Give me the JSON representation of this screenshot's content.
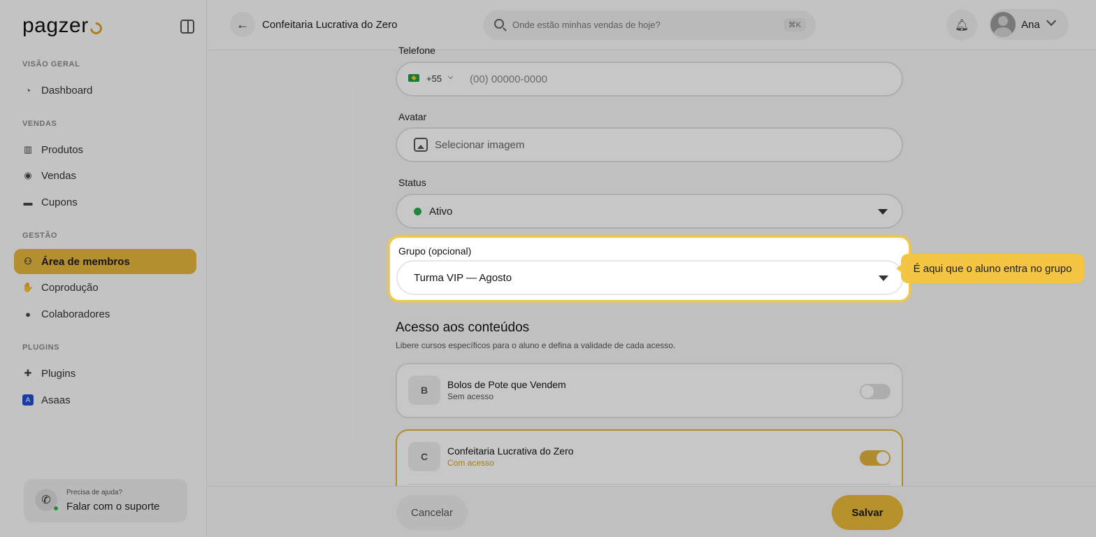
{
  "app": {
    "logo_text": "pagzer",
    "logo_accent": "#e2a21c"
  },
  "sidebar": {
    "sections": [
      {
        "title": "VISÃO GERAL"
      },
      {
        "title": "VENDAS"
      },
      {
        "title": "GESTÃO"
      },
      {
        "title": "PLUGINS"
      }
    ],
    "items": [
      {
        "label": "Dashboard",
        "icon": "gauge-icon"
      },
      {
        "label": "Produtos",
        "icon": "products-icon"
      },
      {
        "label": "Vendas",
        "icon": "sales-icon"
      },
      {
        "label": "Cupons",
        "icon": "coupon-icon"
      },
      {
        "label": "Área de membros",
        "icon": "users-icon",
        "active": true
      },
      {
        "label": "Coprodução",
        "icon": "handshake-icon"
      },
      {
        "label": "Colaboradores",
        "icon": "person-icon"
      },
      {
        "label": "Plugins",
        "icon": "puzzle-icon"
      },
      {
        "label": "Asaas",
        "icon": "asaas-icon"
      }
    ],
    "help": {
      "small": "Precisa de ajuda?",
      "big": "Falar com o suporte"
    }
  },
  "header": {
    "title": "Confeitaria Lucrativa do Zero",
    "search_placeholder": "Onde estão minhas vendas de hoje?",
    "shortcut": "⌘K",
    "user_name": "Ana"
  },
  "form": {
    "phone": {
      "label": "Telefone",
      "country_code": "+55",
      "placeholder": "(00) 00000-0000"
    },
    "avatar": {
      "label": "Avatar",
      "placeholder": "Selecionar imagem"
    },
    "status": {
      "label": "Status",
      "value": "Ativo",
      "color": "#27ae4a"
    },
    "group": {
      "label": "Grupo (opcional)",
      "value": "Turma VIP — Agosto"
    }
  },
  "tooltip": "É aqui que o aluno entra no grupo",
  "access": {
    "heading": "Acesso aos conteúdos",
    "subtitle": "Libere cursos específicos para o aluno e defina a validade de cada acesso.",
    "courses": [
      {
        "letter": "B",
        "title": "Bolos de Pote que Vendem",
        "status": "Sem acesso",
        "enabled": false
      },
      {
        "letter": "C",
        "title": "Confeitaria Lucrativa do Zero",
        "status": "Com acesso",
        "enabled": true
      }
    ]
  },
  "footer": {
    "cancel": "Cancelar",
    "save": "Salvar"
  },
  "colors": {
    "accent": "#e6b83d",
    "tooltip": "#f4c542"
  }
}
